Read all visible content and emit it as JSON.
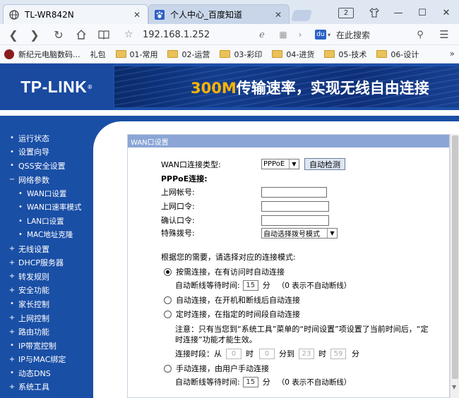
{
  "browser": {
    "tabs": [
      {
        "label": "TL-WR842N",
        "icon": "globe-icon",
        "active": true
      },
      {
        "label": "个人中心_百度知道",
        "icon": "paw-icon",
        "active": false
      }
    ],
    "tab_count": "2",
    "url": "192.168.1.252",
    "search_placeholder": "在此搜索",
    "search_engine_icon": "paw-icon",
    "bookmarks": [
      {
        "label": "新纪元电脑数码...",
        "type": "site"
      },
      {
        "label": "礼包",
        "type": "text"
      },
      {
        "label": "01-常用",
        "type": "folder"
      },
      {
        "label": "02-运营",
        "type": "folder"
      },
      {
        "label": "03-彩印",
        "type": "folder"
      },
      {
        "label": "04-进货",
        "type": "folder"
      },
      {
        "label": "05-技术",
        "type": "folder"
      },
      {
        "label": "06-设计",
        "type": "folder"
      }
    ]
  },
  "header": {
    "logo": "TP-LINK",
    "logo_mark": "®",
    "slogan_highlight": "300M",
    "slogan_rest": "传输速率，实现无线自由连接"
  },
  "sidebar": {
    "items": [
      {
        "label": "运行状态",
        "bullet": "•",
        "sub": false
      },
      {
        "label": "设置向导",
        "bullet": "•",
        "sub": false
      },
      {
        "label": "QSS安全设置",
        "bullet": "•",
        "sub": false
      },
      {
        "label": "网络参数",
        "bullet": "−",
        "sub": false
      },
      {
        "label": "WAN口设置",
        "bullet": "•",
        "sub": true
      },
      {
        "label": "WAN口速率模式",
        "bullet": "•",
        "sub": true
      },
      {
        "label": "LAN口设置",
        "bullet": "•",
        "sub": true
      },
      {
        "label": "MAC地址克隆",
        "bullet": "•",
        "sub": true
      },
      {
        "label": "无线设置",
        "bullet": "+",
        "sub": false
      },
      {
        "label": "DHCP服务器",
        "bullet": "+",
        "sub": false
      },
      {
        "label": "转发规则",
        "bullet": "+",
        "sub": false
      },
      {
        "label": "安全功能",
        "bullet": "+",
        "sub": false
      },
      {
        "label": "家长控制",
        "bullet": "•",
        "sub": false
      },
      {
        "label": "上网控制",
        "bullet": "+",
        "sub": false
      },
      {
        "label": "路由功能",
        "bullet": "+",
        "sub": false
      },
      {
        "label": "IP带宽控制",
        "bullet": "•",
        "sub": false
      },
      {
        "label": "IP与MAC绑定",
        "bullet": "+",
        "sub": false
      },
      {
        "label": "动态DNS",
        "bullet": "•",
        "sub": false
      },
      {
        "label": "系统工具",
        "bullet": "+",
        "sub": false
      }
    ]
  },
  "panel": {
    "title": "WAN口设置",
    "conn_type_label": "WAN口连接类型:",
    "conn_type_value": "PPPoE",
    "auto_detect": "自动检测",
    "pppoe_label": "PPPoE连接:",
    "account_label": "上网帐号:",
    "password_label": "上网口令:",
    "confirm_label": "确认口令:",
    "dial_label": "特殊拨号:",
    "dial_value": "自动选择拨号模式",
    "mode_intro": "根据您的需要，请选择对应的连接模式:",
    "opt_demand": "按需连接，在有访问时自动连接",
    "idle_label": "自动断线等待时间:",
    "idle_value": "15",
    "idle_unit": "分",
    "idle_note": "（0 表示不自动断线）",
    "opt_auto": "自动连接，在开机和断线后自动连接",
    "opt_timed": "定时连接，在指定的时间段自动连接",
    "notice_1": "注意：只有当您到“系统工具”菜单的“时间设置”项设置了当前时间后，“定",
    "notice_2": "时连接”功能才能生效。",
    "period_from": "连接时段：从",
    "t1": "0",
    "hour": "时",
    "t2": "0",
    "minute_to": "分到",
    "t3": "23",
    "hour2": "时",
    "t4": "59",
    "minute": "分",
    "opt_manual": "手动连接，由用户手动连接",
    "idle_label_2": "自动断线等待时间:",
    "idle_value_2": "15",
    "idle_unit_2": "分",
    "idle_note_2": "（0 表示不自动断线）"
  }
}
